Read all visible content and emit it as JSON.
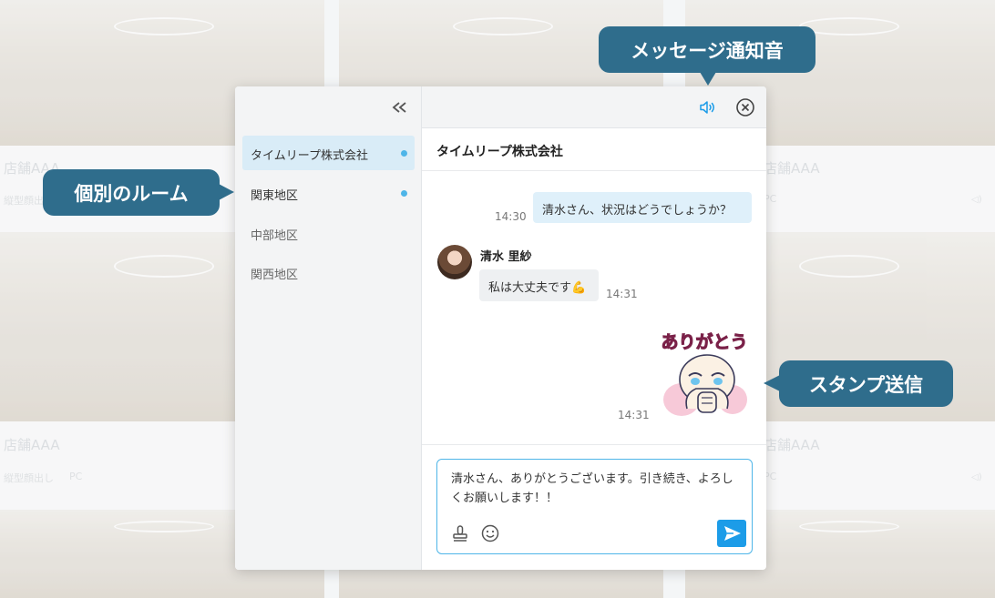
{
  "background": {
    "tiles": [
      {
        "store": "店舗AAA",
        "sub": "縦型顔出し",
        "device": "PC"
      },
      {
        "store": "店舗AAA",
        "sub": "縦型顔出し",
        "device": "PC"
      },
      {
        "store": "店舗AAA",
        "sub": "縦型顔出し",
        "device": "PC"
      },
      {
        "store": "店舗AAA",
        "sub": "縦型顔出し",
        "device": "PC"
      }
    ]
  },
  "sidebar": {
    "rooms": [
      {
        "label": "タイムリープ株式会社",
        "unread": true,
        "active": true
      },
      {
        "label": "関東地区",
        "unread": true,
        "active": false
      },
      {
        "label": "中部地区",
        "unread": false,
        "active": false
      },
      {
        "label": "関西地区",
        "unread": false,
        "active": false
      }
    ]
  },
  "chat": {
    "room_title": "タイムリープ株式会社",
    "messages": {
      "outgoing_1": {
        "text": "清水さん、状況はどうでしょうか？",
        "time": "14:30"
      },
      "incoming_1": {
        "sender": "清水 里紗",
        "text": "私は大丈夫です💪",
        "time": "14:31"
      },
      "sticker": {
        "text": "ありがとう",
        "time": "14:31"
      }
    },
    "input_value": "清水さん、ありがとうございます。引き続き、よろしくお願いします！！"
  },
  "callouts": {
    "notification_sound": "メッセージ通知音",
    "individual_rooms": "個別のルーム",
    "sticker_send": "スタンプ送信"
  },
  "colors": {
    "accent": "#1c9ce8",
    "unread_dot": "#4eb5e8",
    "callout_bg": "#2f6d8c",
    "active_room_bg": "#d9ecf7"
  },
  "icons": {
    "collapse": "double-chevron-left-icon",
    "sound": "speaker-icon",
    "close": "close-circle-icon",
    "stamp": "stamp-icon",
    "emoji": "smiley-icon",
    "send": "send-icon"
  }
}
